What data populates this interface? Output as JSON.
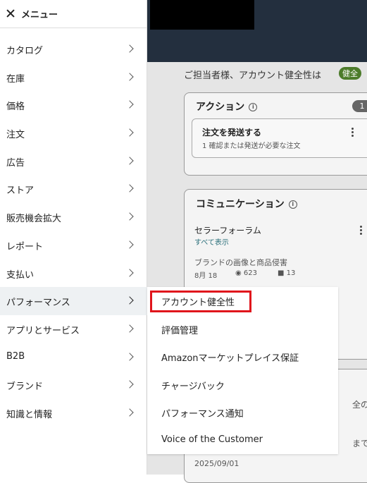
{
  "background": {
    "greeting": "ご担当者様、アカウント健全性は",
    "health_badge": "健全",
    "action_card": {
      "title": "アクション",
      "count": "1",
      "item_title": "注文を発送する",
      "item_sub": "1 確認または発送が必要な注文"
    },
    "communication_card": {
      "title": "コミュニケーション",
      "forum_title": "セラーフォーラム",
      "view_all": "すべて表示",
      "post_title": "ブランドの画像と商品侵害",
      "post_date": "8月 18",
      "post_views": "623",
      "post_comments": "13"
    },
    "partial_text_1": "全の更",
    "partial_text_2": "までに",
    "partial_date": "2025/09/01"
  },
  "menu": {
    "title": "メニュー",
    "items": [
      {
        "label": "カタログ"
      },
      {
        "label": "在庫"
      },
      {
        "label": "価格"
      },
      {
        "label": "注文"
      },
      {
        "label": "広告"
      },
      {
        "label": "ストア"
      },
      {
        "label": "販売機会拡大"
      },
      {
        "label": "レポート"
      },
      {
        "label": "支払い"
      },
      {
        "label": "パフォーマンス"
      },
      {
        "label": "アプリとサービス"
      },
      {
        "label": "B2B"
      },
      {
        "label": "ブランド"
      },
      {
        "label": "知識と情報"
      }
    ]
  },
  "submenu": {
    "items": [
      {
        "label": "アカウント健全性"
      },
      {
        "label": "評価管理"
      },
      {
        "label": "Amazonマーケットプレイス保証"
      },
      {
        "label": "チャージバック"
      },
      {
        "label": "パフォーマンス通知"
      },
      {
        "label": "Voice of the Customer"
      }
    ]
  }
}
